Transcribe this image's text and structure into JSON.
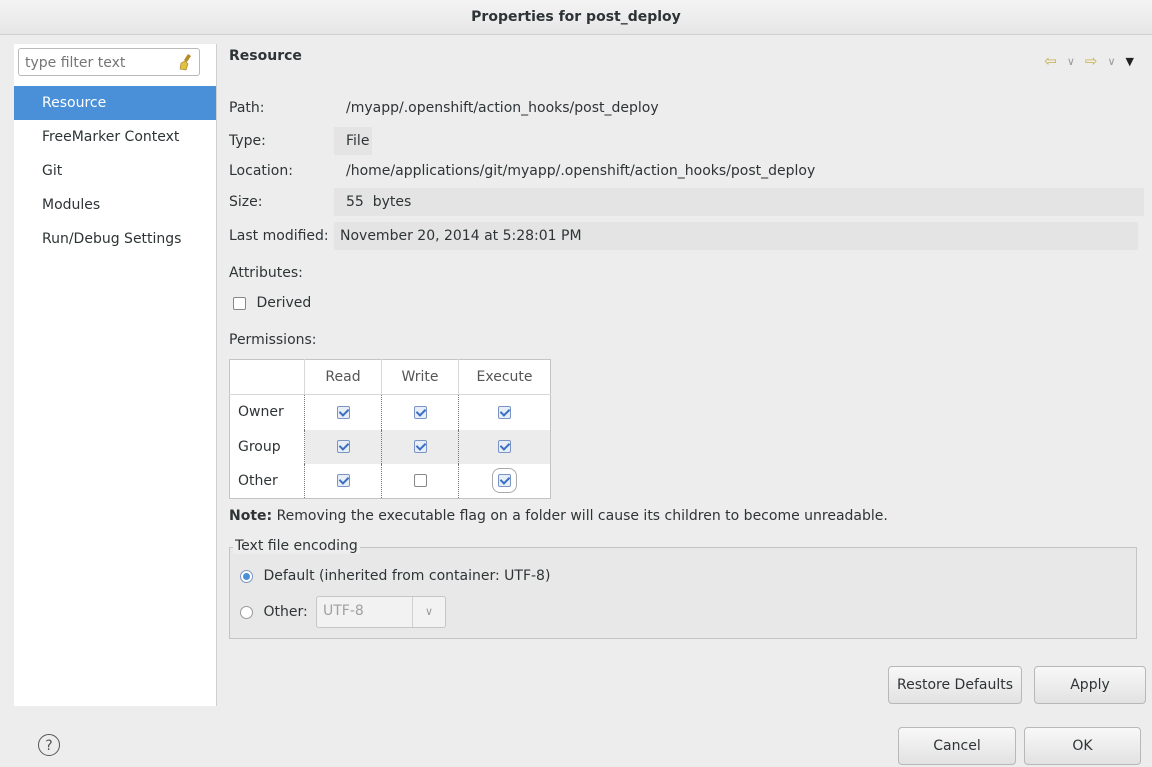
{
  "window": {
    "title": "Properties for post_deploy"
  },
  "filter": {
    "placeholder": "type filter text"
  },
  "nav": {
    "items": [
      {
        "label": "Resource"
      },
      {
        "label": "FreeMarker Context"
      },
      {
        "label": "Git"
      },
      {
        "label": "Modules"
      },
      {
        "label": "Run/Debug Settings"
      }
    ]
  },
  "panel": {
    "title": "Resource",
    "path_label": "Path:",
    "path_value": "/myapp/.openshift/action_hooks/post_deploy",
    "type_label": "Type:",
    "type_value": "File",
    "location_label": "Location:",
    "location_value": "/home/applications/git/myapp/.openshift/action_hooks/post_deploy",
    "size_label": "Size:",
    "size_value": "55  bytes",
    "modified_label": "Last modified:",
    "modified_value": "November 20, 2014 at 5:28:01 PM",
    "attributes_label": "Attributes:",
    "derived_label": "Derived",
    "permissions_label": "Permissions:"
  },
  "permissions": {
    "columns": [
      "Read",
      "Write",
      "Execute"
    ],
    "rows": [
      {
        "name": "Owner",
        "read": true,
        "write": true,
        "execute": true
      },
      {
        "name": "Group",
        "read": true,
        "write": true,
        "execute": true
      },
      {
        "name": "Other",
        "read": true,
        "write": false,
        "execute": true
      }
    ]
  },
  "note": {
    "bold": "Note:",
    "text": " Removing the executable flag on a folder will cause its children to become unreadable."
  },
  "encoding": {
    "legend": "Text file encoding",
    "default_label": "Default (inherited from container: UTF-8)",
    "other_label": "Other:",
    "other_value": "UTF-8"
  },
  "buttons": {
    "restore_defaults": "Restore Defaults",
    "apply": "Apply",
    "cancel": "Cancel",
    "ok": "OK",
    "help": "?"
  },
  "icons": {
    "back": "back-arrow-icon",
    "forward": "forward-arrow-icon",
    "menu": "view-menu-icon",
    "clear": "clear-filter-icon",
    "help": "help-icon"
  }
}
